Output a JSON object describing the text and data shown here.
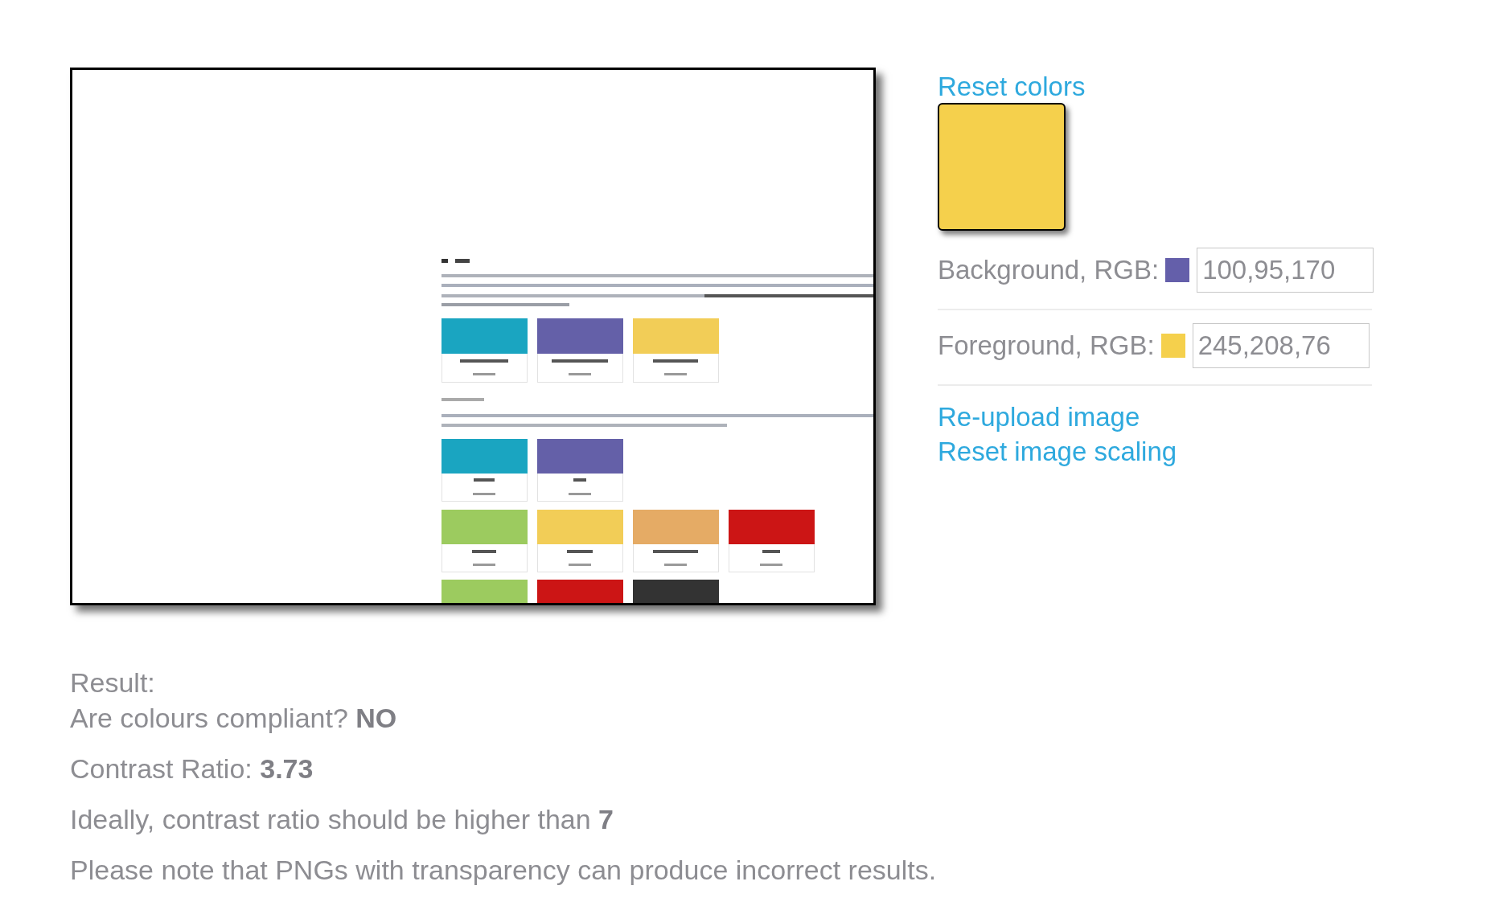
{
  "controls": {
    "reset_colors_link": "Reset colors",
    "fields": [
      {
        "kind": "background",
        "label": "Background, RGB:",
        "color": "#645faa",
        "value": "100,95,170"
      },
      {
        "kind": "foreground",
        "label": "Foreground, RGB:",
        "color": "#f5d04c",
        "value": "245,208,76"
      }
    ],
    "links": [
      "Re-upload image",
      "Reset image scaling"
    ]
  },
  "result": {
    "heading": "Result:",
    "lines": [
      "Are colours compliant? **NO**",
      "Contrast Ratio: **3.73**",
      "Ideally, contrast ratio should be higher than **7**",
      "Please note that PNGs with transparency can produce incorrect results."
    ]
  }
}
